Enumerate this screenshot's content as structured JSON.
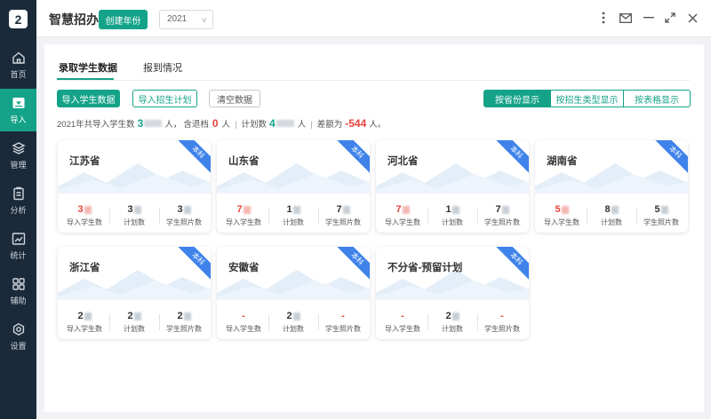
{
  "app": {
    "title": "智慧招办",
    "create_year_button": "创建年份",
    "year": "2021",
    "year_chevron": "v"
  },
  "window": {
    "more_icon": "vertical-dots-icon",
    "mail_icon": "mail-icon",
    "minimize_icon": "minimize-icon",
    "maximize_icon": "expand-icon",
    "close_icon": "close-icon"
  },
  "sidebar": {
    "logo": "2",
    "items": [
      {
        "label": "首页",
        "icon": "home-icon"
      },
      {
        "label": "导入",
        "icon": "import-icon",
        "active": true
      },
      {
        "label": "管理",
        "icon": "layers-icon"
      },
      {
        "label": "分析",
        "icon": "clipboard-icon"
      },
      {
        "label": "统计",
        "icon": "chart-icon"
      },
      {
        "label": "辅助",
        "icon": "grid-icon"
      },
      {
        "label": "设置",
        "icon": "gear-icon"
      }
    ]
  },
  "tabs": [
    {
      "label": "录取学生数据",
      "active": true
    },
    {
      "label": "报到情况",
      "active": false
    }
  ],
  "actions": {
    "import_students": "导入学生数据",
    "import_plan": "导入招生计划",
    "clear": "清空数据"
  },
  "view_modes": [
    {
      "label": "按省份显示",
      "active": true
    },
    {
      "label": "按招生类型显示",
      "active": false
    },
    {
      "label": "按表格显示",
      "active": false
    }
  ],
  "summary": {
    "prefix": "2021年共导入学生数",
    "students_value": "3",
    "unit": "人，",
    "withdrawn_label": "含退档",
    "withdrawn_value": "0",
    "withdrawn_unit": "人",
    "divider": "|",
    "plan_label": "计划数",
    "plan_value": "4",
    "plan_unit": "人",
    "diff_label": "差额为",
    "diff_value": "-544",
    "diff_unit": "人。"
  },
  "stat_labels": {
    "imported": "导入学生数",
    "plan": "计划数",
    "photos": "学生照片数"
  },
  "provinces": [
    {
      "name": "江苏省",
      "badge": "本科",
      "imported": "3",
      "plan": "3",
      "photos": "3",
      "imported_red": true
    },
    {
      "name": "山东省",
      "badge": "本科",
      "imported": "7",
      "plan": "1",
      "photos": "7",
      "imported_red": true
    },
    {
      "name": "河北省",
      "badge": "本科",
      "imported": "7",
      "plan": "1",
      "photos": "7",
      "imported_red": true
    },
    {
      "name": "湖南省",
      "badge": "本科",
      "imported": "5",
      "plan": "8",
      "photos": "5",
      "imported_red": true
    },
    {
      "name": "浙江省",
      "badge": "本科",
      "imported": "2",
      "plan": "2",
      "photos": "2",
      "imported_red": false
    },
    {
      "name": "安徽省",
      "badge": "本科",
      "imported": "-",
      "plan": "2",
      "photos": "-",
      "imported_red": true
    },
    {
      "name": "不分省-预留计划",
      "badge": "本科",
      "imported": "-",
      "plan": "2",
      "photos": "-",
      "imported_red": true
    }
  ],
  "colors": {
    "accent": "#14a389",
    "sidebar": "#1b2a3a",
    "badge": "#3f83ea",
    "negative": "#e8423c"
  }
}
